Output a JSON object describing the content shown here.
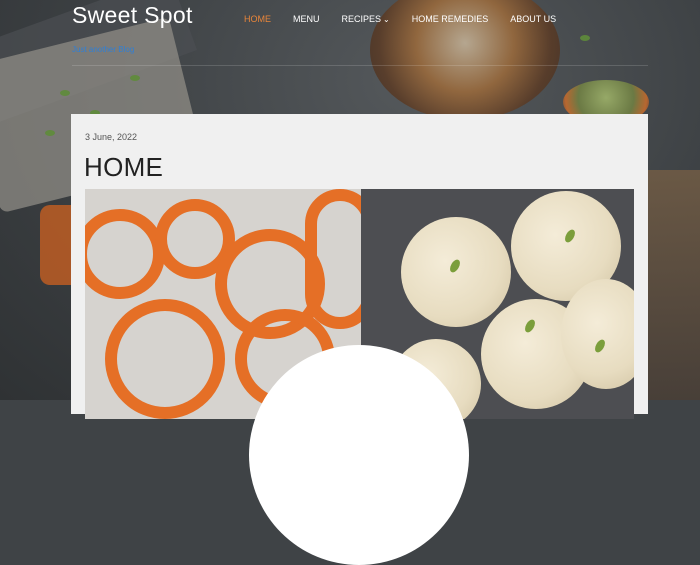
{
  "site": {
    "title": "Sweet Spot",
    "tagline": "Just another Blog"
  },
  "nav": {
    "items": [
      {
        "label": "HOME",
        "active": true
      },
      {
        "label": "MENU"
      },
      {
        "label": "RECIPES",
        "has_submenu": true
      },
      {
        "label": "HOME REMEDIES"
      },
      {
        "label": "ABOUT US"
      }
    ],
    "accent_color": "#e8853a"
  },
  "post": {
    "date": "3 June, 2022",
    "title": "HOME"
  },
  "icons": {
    "submenu": "chevron-down-icon"
  }
}
